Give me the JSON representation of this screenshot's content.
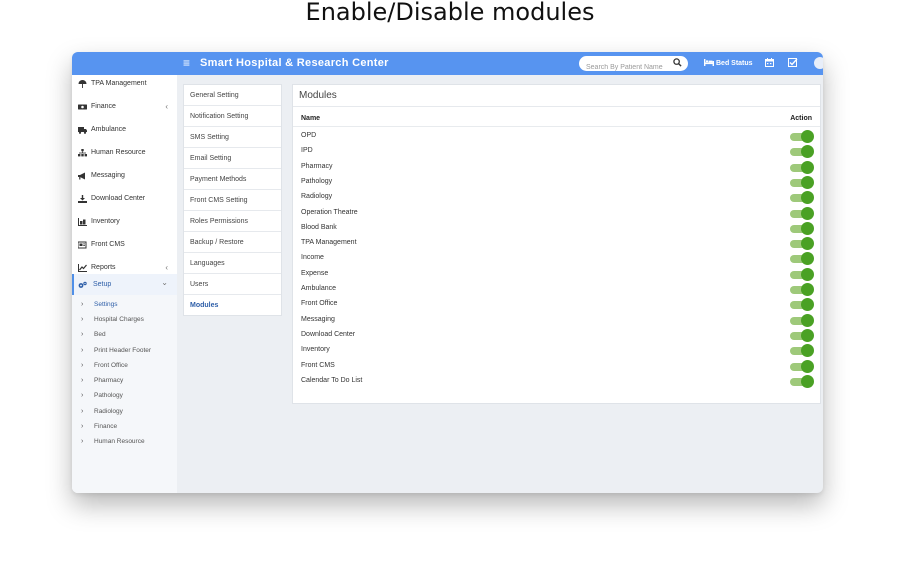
{
  "page_heading": "Enable/Disable modules",
  "topbar": {
    "app_title": "Smart Hospital & Research Center",
    "search_placeholder": "Search By Patient Name",
    "bed_status_label": "Bed Status"
  },
  "sidebar": {
    "items": [
      {
        "label": "TPA Management",
        "icon": "umbrella-icon",
        "has_chevron": false
      },
      {
        "label": "Finance",
        "icon": "money-icon",
        "has_chevron": true
      },
      {
        "label": "Ambulance",
        "icon": "ambulance-icon",
        "has_chevron": false
      },
      {
        "label": "Human Resource",
        "icon": "sitemap-icon",
        "has_chevron": false
      },
      {
        "label": "Messaging",
        "icon": "bullhorn-icon",
        "has_chevron": false
      },
      {
        "label": "Download Center",
        "icon": "download-icon",
        "has_chevron": false
      },
      {
        "label": "Inventory",
        "icon": "inventory-icon",
        "has_chevron": false
      },
      {
        "label": "Front CMS",
        "icon": "cms-icon",
        "has_chevron": false
      },
      {
        "label": "Reports",
        "icon": "chart-icon",
        "has_chevron": true
      },
      {
        "label": "Setup",
        "icon": "gears-icon",
        "has_chevron": true,
        "expanded": true
      }
    ],
    "sub_items": [
      {
        "label": "Settings",
        "active": true
      },
      {
        "label": "Hospital Charges"
      },
      {
        "label": "Bed"
      },
      {
        "label": "Print Header Footer"
      },
      {
        "label": "Front Office"
      },
      {
        "label": "Pharmacy"
      },
      {
        "label": "Pathology"
      },
      {
        "label": "Radiology"
      },
      {
        "label": "Finance"
      },
      {
        "label": "Human Resource"
      }
    ],
    "chevron_left": "‹",
    "chevron_down": "⌄",
    "arrow": "›"
  },
  "settings_menu": {
    "items": [
      {
        "label": "General Setting"
      },
      {
        "label": "Notification Setting"
      },
      {
        "label": "SMS Setting"
      },
      {
        "label": "Email Setting"
      },
      {
        "label": "Payment Methods"
      },
      {
        "label": "Front CMS Setting"
      },
      {
        "label": "Roles Permissions"
      },
      {
        "label": "Backup / Restore"
      },
      {
        "label": "Languages"
      },
      {
        "label": "Users"
      },
      {
        "label": "Modules",
        "active": true
      }
    ]
  },
  "modules": {
    "title": "Modules",
    "col_name": "Name",
    "col_action": "Action",
    "rows": [
      {
        "name": "OPD",
        "enabled": true
      },
      {
        "name": "IPD",
        "enabled": true
      },
      {
        "name": "Pharmacy",
        "enabled": true
      },
      {
        "name": "Pathology",
        "enabled": true
      },
      {
        "name": "Radiology",
        "enabled": true
      },
      {
        "name": "Operation Theatre",
        "enabled": true
      },
      {
        "name": "Blood Bank",
        "enabled": true
      },
      {
        "name": "TPA Management",
        "enabled": true
      },
      {
        "name": "Income",
        "enabled": true
      },
      {
        "name": "Expense",
        "enabled": true
      },
      {
        "name": "Ambulance",
        "enabled": true
      },
      {
        "name": "Front Office",
        "enabled": true
      },
      {
        "name": "Messaging",
        "enabled": true
      },
      {
        "name": "Download Center",
        "enabled": true
      },
      {
        "name": "Inventory",
        "enabled": true
      },
      {
        "name": "Front CMS",
        "enabled": true
      },
      {
        "name": "Calendar To Do List",
        "enabled": true
      }
    ]
  },
  "colors": {
    "topbar": "#5794f0",
    "toggle_on_knob": "#4aa124",
    "toggle_on_track": "#9ec97a",
    "active_link": "#2d5ea8"
  }
}
